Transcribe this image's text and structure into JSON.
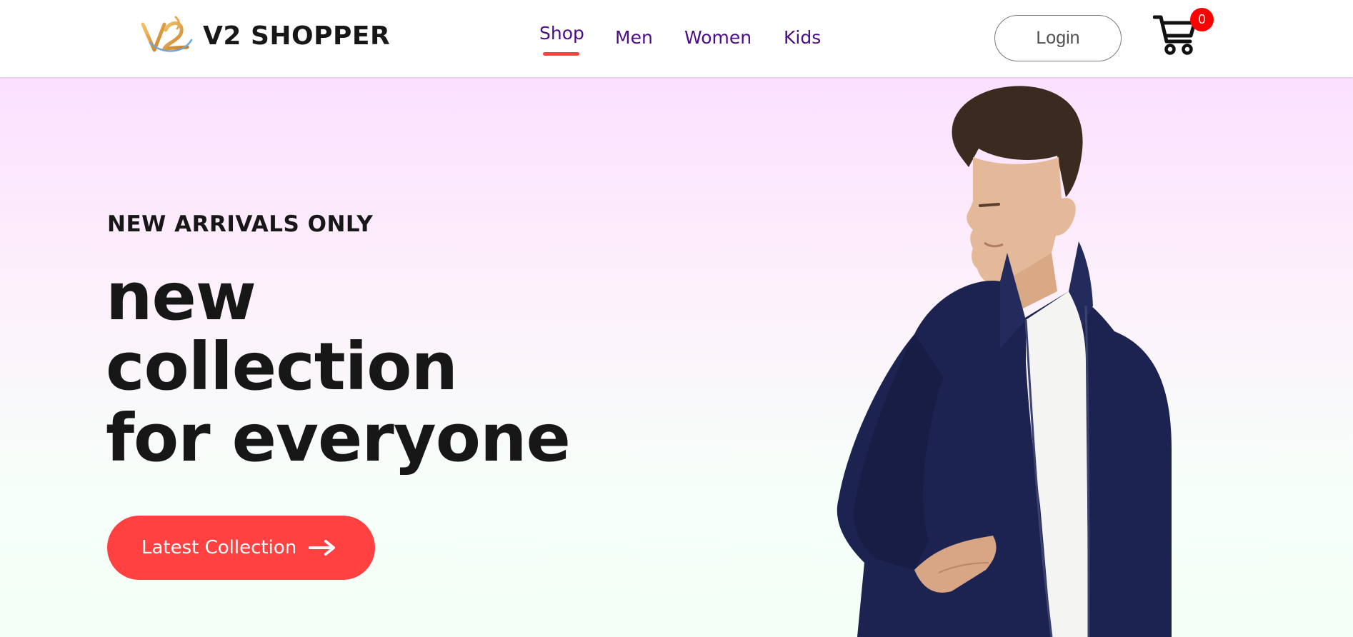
{
  "brand": {
    "name": "V2 SHOPPER",
    "logo_mark": "V2",
    "logo_icon": "v2-monogram-logo"
  },
  "nav": {
    "items": [
      {
        "label": "Shop",
        "active": true
      },
      {
        "label": "Men",
        "active": false
      },
      {
        "label": "Women",
        "active": false
      },
      {
        "label": "Kids",
        "active": false
      }
    ],
    "active_underline_color": "#ff4141",
    "link_color": "#4a0d86"
  },
  "header": {
    "login_label": "Login",
    "cart_icon": "shopping-cart-icon",
    "cart_count": "0",
    "cart_badge_color": "#ff0000"
  },
  "hero": {
    "eyebrow": "NEW ARRIVALS ONLY",
    "headline_lines": [
      "new",
      "collection",
      "for everyone"
    ],
    "cta_label": "Latest Collection",
    "cta_icon": "arrow-right-icon",
    "cta_color": "#ff4141",
    "image": "model-in-navy-jacket-photo",
    "gradient_top": "#fbe0ff",
    "gradient_bottom": "#f4fff8"
  }
}
